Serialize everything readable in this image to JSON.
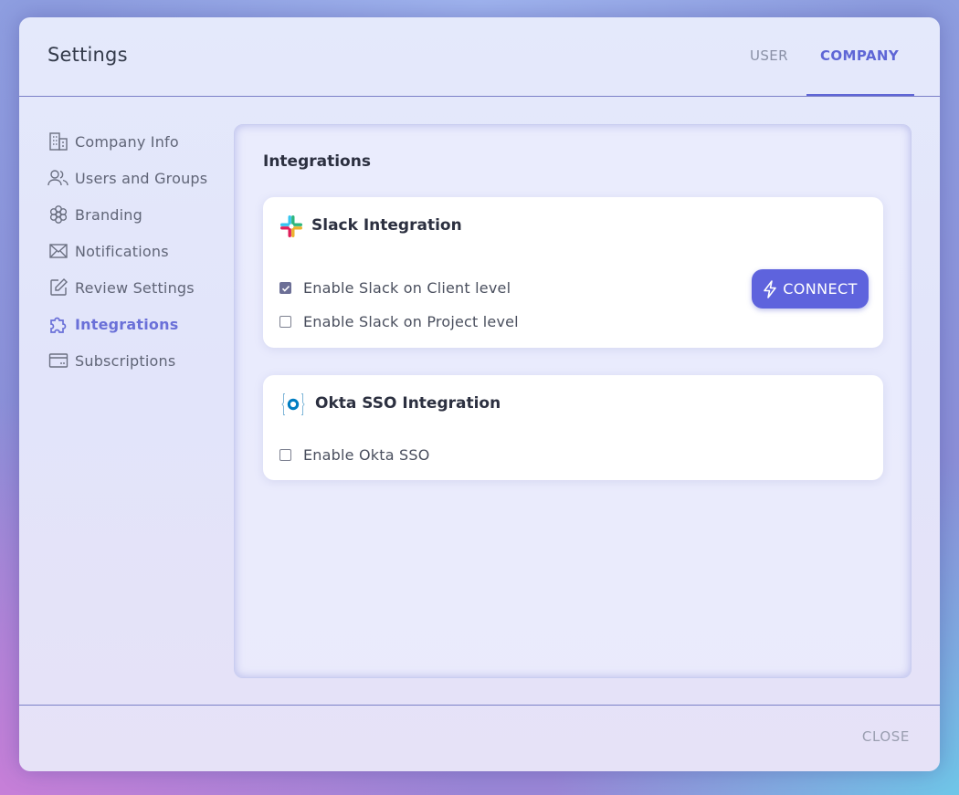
{
  "header": {
    "title": "Settings",
    "tabs": [
      {
        "label": "USER",
        "active": false
      },
      {
        "label": "COMPANY",
        "active": true
      }
    ]
  },
  "sidebar": {
    "items": [
      {
        "label": "Company Info",
        "icon": "building-icon",
        "active": false
      },
      {
        "label": "Users and Groups",
        "icon": "users-icon",
        "active": false
      },
      {
        "label": "Branding",
        "icon": "flower-icon",
        "active": false
      },
      {
        "label": "Notifications",
        "icon": "envelope-icon",
        "active": false
      },
      {
        "label": "Review Settings",
        "icon": "edit-icon",
        "active": false
      },
      {
        "label": "Integrations",
        "icon": "puzzle-icon",
        "active": true
      },
      {
        "label": "Subscriptions",
        "icon": "credit-card-icon",
        "active": false
      }
    ]
  },
  "main": {
    "title": "Integrations",
    "slack": {
      "title": "Slack Integration",
      "icon": "slack-logo-icon",
      "client_level": {
        "label": "Enable Slack on Client level",
        "checked": true
      },
      "project_level": {
        "label": "Enable Slack on Project level",
        "checked": false
      },
      "connect_label": "CONNECT"
    },
    "okta": {
      "title": "Okta SSO Integration",
      "icon": "okta-logo-icon",
      "enable": {
        "label": "Enable Okta SSO",
        "checked": false
      }
    }
  },
  "footer": {
    "close_label": "CLOSE"
  },
  "colors": {
    "accent": "#5e63dd",
    "active_nav": "#6a70d8",
    "divider": "#7b80c8"
  }
}
